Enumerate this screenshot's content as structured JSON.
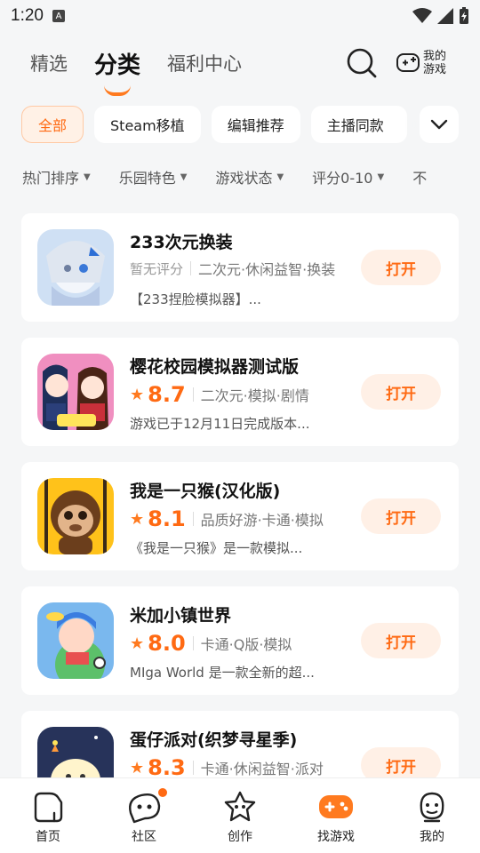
{
  "status": {
    "time": "1:20",
    "a_badge": "A"
  },
  "topnav": {
    "tabs": [
      {
        "label": "精选"
      },
      {
        "label": "分类"
      },
      {
        "label": "福利中心"
      }
    ],
    "my_games": "我的游戏"
  },
  "chips": [
    {
      "label": "全部"
    },
    {
      "label": "Steam移植"
    },
    {
      "label": "编辑推荐"
    },
    {
      "label": "主播同款"
    }
  ],
  "filters": [
    {
      "label": "热门排序"
    },
    {
      "label": "乐园特色"
    },
    {
      "label": "游戏状态"
    },
    {
      "label": "评分0-10"
    },
    {
      "label": "不"
    }
  ],
  "games": [
    {
      "name": "233次元换装",
      "score": "",
      "no_score": "暂无评分",
      "tags": "二次元·休闲益智·换装",
      "desc": "【233捏脸模拟器】...",
      "button": "打开"
    },
    {
      "name": "樱花校园模拟器测试版",
      "score": "8.7",
      "tags": "二次元·模拟·剧情",
      "desc": "游戏已于12月11日完成版本...",
      "button": "打开"
    },
    {
      "name": "我是一只猴(汉化版)",
      "score": "8.1",
      "tags": "品质好游·卡通·模拟",
      "desc": "《我是一只猴》是一款模拟...",
      "button": "打开"
    },
    {
      "name": "米加小镇世界",
      "score": "8.0",
      "tags": "卡通·Q版·模拟",
      "desc": "MIga World 是一款全新的超...",
      "button": "打开"
    },
    {
      "name": "蛋仔派对(织梦寻星季)",
      "score": "8.3",
      "tags": "卡通·休闲益智·派对",
      "desc": "",
      "button": "打开"
    }
  ],
  "bottomnav": [
    {
      "label": "首页"
    },
    {
      "label": "社区"
    },
    {
      "label": "创作"
    },
    {
      "label": "找游戏"
    },
    {
      "label": "我的"
    }
  ],
  "colors": {
    "accent": "#ff6a13",
    "accent_bg": "#fff0e6"
  }
}
